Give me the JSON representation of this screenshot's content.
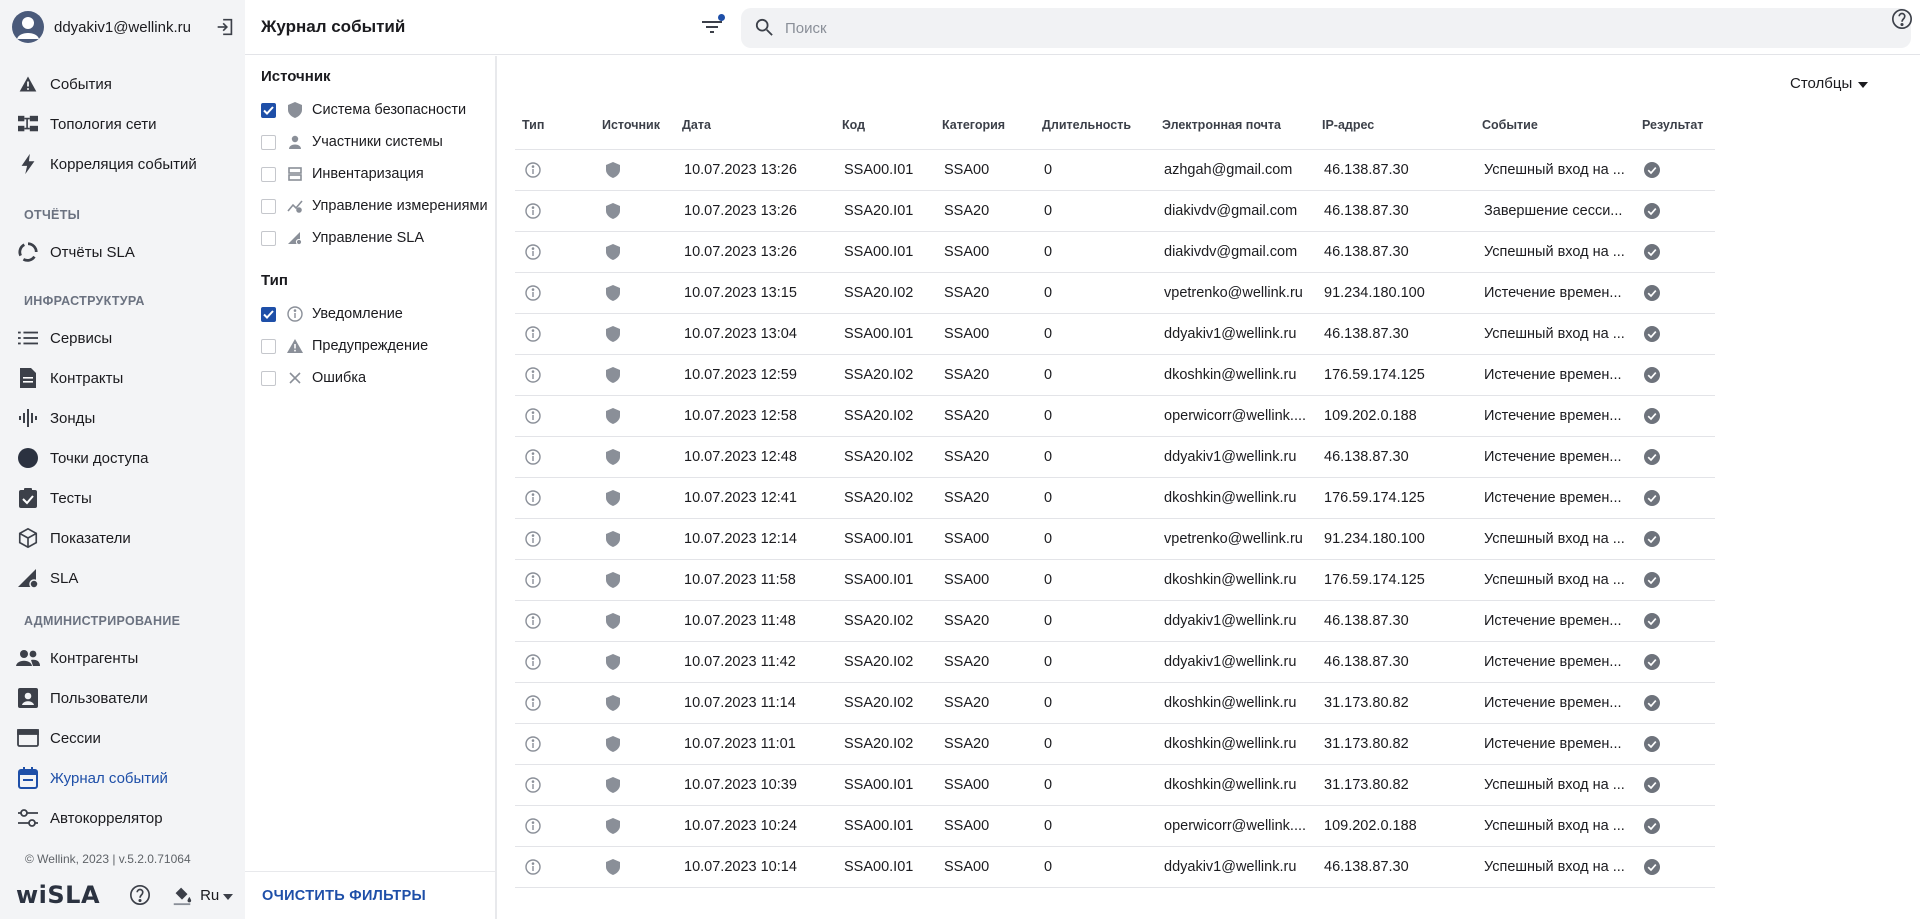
{
  "user": {
    "email": "ddyakiv1@wellink.ru"
  },
  "nav": {
    "items_top": [
      {
        "label": "События",
        "icon": "warning-icon"
      },
      {
        "label": "Топология сети",
        "icon": "topology-icon"
      },
      {
        "label": "Корреляция событий",
        "icon": "bolt-icon"
      }
    ],
    "section_reports": "ОТЧЁТЫ",
    "items_reports": [
      {
        "label": "Отчёты SLA",
        "icon": "circle-progress-icon"
      }
    ],
    "section_infra": "ИНФРАСТРУКТУРА",
    "items_infra": [
      {
        "label": "Сервисы",
        "icon": "list-icon"
      },
      {
        "label": "Контракты",
        "icon": "document-icon"
      },
      {
        "label": "Зонды",
        "icon": "probe-icon"
      },
      {
        "label": "Точки доступа",
        "icon": "dot-icon"
      },
      {
        "label": "Тесты",
        "icon": "clipboard-check-icon"
      },
      {
        "label": "Показатели",
        "icon": "cube-icon"
      },
      {
        "label": "SLA",
        "icon": "sla-icon"
      }
    ],
    "section_admin": "АДМИНИСТРИРОВАНИЕ",
    "items_admin": [
      {
        "label": "Контрагенты",
        "icon": "people-icon"
      },
      {
        "label": "Пользователи",
        "icon": "user-badge-icon"
      },
      {
        "label": "Сессии",
        "icon": "window-icon"
      },
      {
        "label": "Журнал событий",
        "icon": "calendar-icon"
      },
      {
        "label": "Автокоррелятор",
        "icon": "sliders-icon"
      }
    ]
  },
  "footer": {
    "version": "© Wellink, 2023 | v.5.2.0.71064",
    "logo": "wiSLA",
    "language": "Ru"
  },
  "header": {
    "title": "Журнал событий",
    "search_placeholder": "Поиск"
  },
  "filters": {
    "source_title": "Источник",
    "source": [
      {
        "label": "Система безопасности",
        "checked": true,
        "icon": "shield-icon"
      },
      {
        "label": "Участники системы",
        "checked": false,
        "icon": "person-icon"
      },
      {
        "label": "Инвентаризация",
        "checked": false,
        "icon": "inventory-icon"
      },
      {
        "label": "Управление измерениями",
        "checked": false,
        "icon": "measure-icon"
      },
      {
        "label": "Управление SLA",
        "checked": false,
        "icon": "sla-icon"
      }
    ],
    "type_title": "Тип",
    "type": [
      {
        "label": "Уведомление",
        "checked": true,
        "icon": "info-icon"
      },
      {
        "label": "Предупреждение",
        "checked": false,
        "icon": "warning-icon"
      },
      {
        "label": "Ошибка",
        "checked": false,
        "icon": "close-icon"
      }
    ],
    "clear_label": "ОЧИСТИТЬ ФИЛЬТРЫ"
  },
  "table": {
    "columns_button": "Столбцы",
    "headers": [
      "Тип",
      "Источник",
      "Дата",
      "Код",
      "Категория",
      "Длительность",
      "Электронная почта",
      "IP-адрес",
      "Событие",
      "Результат"
    ],
    "rows": [
      {
        "date": "10.07.2023 13:26",
        "code": "SSA00.I01",
        "category": "SSA00",
        "duration": "0",
        "email": "azhgah@gmail.com",
        "ip": "46.138.87.30",
        "event": "Успешный вход на ..."
      },
      {
        "date": "10.07.2023 13:26",
        "code": "SSA20.I01",
        "category": "SSA20",
        "duration": "0",
        "email": "diakivdv@gmail.com",
        "ip": "46.138.87.30",
        "event": "Завершение сесси..."
      },
      {
        "date": "10.07.2023 13:26",
        "code": "SSA00.I01",
        "category": "SSA00",
        "duration": "0",
        "email": "diakivdv@gmail.com",
        "ip": "46.138.87.30",
        "event": "Успешный вход на ..."
      },
      {
        "date": "10.07.2023 13:15",
        "code": "SSA20.I02",
        "category": "SSA20",
        "duration": "0",
        "email": "vpetrenko@wellink.ru",
        "ip": "91.234.180.100",
        "event": "Истечение времен..."
      },
      {
        "date": "10.07.2023 13:04",
        "code": "SSA00.I01",
        "category": "SSA00",
        "duration": "0",
        "email": "ddyakiv1@wellink.ru",
        "ip": "46.138.87.30",
        "event": "Успешный вход на ..."
      },
      {
        "date": "10.07.2023 12:59",
        "code": "SSA20.I02",
        "category": "SSA20",
        "duration": "0",
        "email": "dkoshkin@wellink.ru",
        "ip": "176.59.174.125",
        "event": "Истечение времен..."
      },
      {
        "date": "10.07.2023 12:58",
        "code": "SSA20.I02",
        "category": "SSA20",
        "duration": "0",
        "email": "operwicorr@wellink....",
        "ip": "109.202.0.188",
        "event": "Истечение времен..."
      },
      {
        "date": "10.07.2023 12:48",
        "code": "SSA20.I02",
        "category": "SSA20",
        "duration": "0",
        "email": "ddyakiv1@wellink.ru",
        "ip": "46.138.87.30",
        "event": "Истечение времен..."
      },
      {
        "date": "10.07.2023 12:41",
        "code": "SSA20.I02",
        "category": "SSA20",
        "duration": "0",
        "email": "dkoshkin@wellink.ru",
        "ip": "176.59.174.125",
        "event": "Истечение времен..."
      },
      {
        "date": "10.07.2023 12:14",
        "code": "SSA00.I01",
        "category": "SSA00",
        "duration": "0",
        "email": "vpetrenko@wellink.ru",
        "ip": "91.234.180.100",
        "event": "Успешный вход на ..."
      },
      {
        "date": "10.07.2023 11:58",
        "code": "SSA00.I01",
        "category": "SSA00",
        "duration": "0",
        "email": "dkoshkin@wellink.ru",
        "ip": "176.59.174.125",
        "event": "Успешный вход на ..."
      },
      {
        "date": "10.07.2023 11:48",
        "code": "SSA20.I02",
        "category": "SSA20",
        "duration": "0",
        "email": "ddyakiv1@wellink.ru",
        "ip": "46.138.87.30",
        "event": "Истечение времен..."
      },
      {
        "date": "10.07.2023 11:42",
        "code": "SSA20.I02",
        "category": "SSA20",
        "duration": "0",
        "email": "ddyakiv1@wellink.ru",
        "ip": "46.138.87.30",
        "event": "Истечение времен..."
      },
      {
        "date": "10.07.2023 11:14",
        "code": "SSA20.I02",
        "category": "SSA20",
        "duration": "0",
        "email": "dkoshkin@wellink.ru",
        "ip": "31.173.80.82",
        "event": "Истечение времен..."
      },
      {
        "date": "10.07.2023 11:01",
        "code": "SSA20.I02",
        "category": "SSA20",
        "duration": "0",
        "email": "dkoshkin@wellink.ru",
        "ip": "31.173.80.82",
        "event": "Истечение времен..."
      },
      {
        "date": "10.07.2023 10:39",
        "code": "SSA00.I01",
        "category": "SSA00",
        "duration": "0",
        "email": "dkoshkin@wellink.ru",
        "ip": "31.173.80.82",
        "event": "Успешный вход на ..."
      },
      {
        "date": "10.07.2023 10:24",
        "code": "SSA00.I01",
        "category": "SSA00",
        "duration": "0",
        "email": "operwicorr@wellink....",
        "ip": "109.202.0.188",
        "event": "Успешный вход на ..."
      },
      {
        "date": "10.07.2023 10:14",
        "code": "SSA00.I01",
        "category": "SSA00",
        "duration": "0",
        "email": "ddyakiv1@wellink.ru",
        "ip": "46.138.87.30",
        "event": "Успешный вход на ..."
      }
    ]
  },
  "colors": {
    "accent": "#1e4fa8",
    "icon_gray": "#8a8f98",
    "result_gray": "#6e737c"
  }
}
